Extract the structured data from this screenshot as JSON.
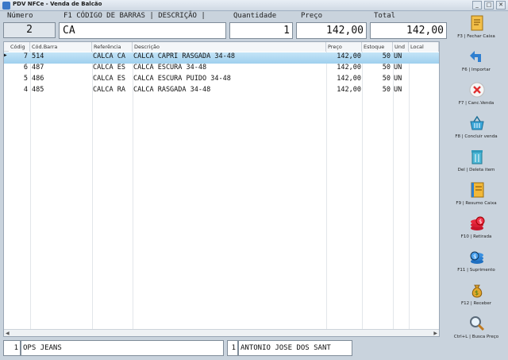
{
  "window": {
    "title": "PDV NFCe - Venda de Balcão"
  },
  "header": {
    "numero_label": "Número",
    "numero_value": "2",
    "busca_label": "F1 CÓDIGO DE BARRAS | DESCRIÇÃO |",
    "busca_value": "CA",
    "quantidade_label": "Quantidade",
    "quantidade_value": "1",
    "preco_label": "Preço",
    "preco_value": "142,00",
    "total_label": "Total",
    "total_value": "142,00"
  },
  "grid": {
    "columns": [
      "Códig",
      "Cód.Barra",
      "Referência",
      "Descrição",
      "Preço",
      "Estoque",
      "Und",
      "Local"
    ],
    "rows": [
      {
        "codigo": "7",
        "cod_barra": "514",
        "referencia": "CALCA CA",
        "descricao": "CALCA CAPRI RASGADA 34-48",
        "preco": "142,00",
        "estoque": "50",
        "und": "UN",
        "local": ""
      },
      {
        "codigo": "6",
        "cod_barra": "487",
        "referencia": "CALCA ES",
        "descricao": "CALCA ESCURA 34-48",
        "preco": "142,00",
        "estoque": "50",
        "und": "UN",
        "local": ""
      },
      {
        "codigo": "5",
        "cod_barra": "486",
        "referencia": "CALCA ES",
        "descricao": "CALCA ESCURA PUIDO 34-48",
        "preco": "142,00",
        "estoque": "50",
        "und": "UN",
        "local": ""
      },
      {
        "codigo": "4",
        "cod_barra": "485",
        "referencia": "CALCA RA",
        "descricao": "CALCA RASGADA 34-48",
        "preco": "142,00",
        "estoque": "50",
        "und": "UN",
        "local": ""
      }
    ],
    "selected_row": 0
  },
  "sidebar": {
    "items": [
      {
        "label": "F3 | Fechar Caixa",
        "icon": "receipt-icon"
      },
      {
        "label": "F6 | Importar",
        "icon": "import-arrow-icon"
      },
      {
        "label": "F7 | Canc.Venda",
        "icon": "cancel-x-icon"
      },
      {
        "label": "F8 | Concluir venda",
        "icon": "basket-icon"
      },
      {
        "label": "Del | Deleta item",
        "icon": "trash-icon"
      },
      {
        "label": "F9 | Resumo Caixa",
        "icon": "notebook-icon"
      },
      {
        "label": "F10 | Retirada",
        "icon": "coins-red-icon"
      },
      {
        "label": "F11 | Suprimento",
        "icon": "coins-blue-icon"
      },
      {
        "label": "F12 | Receber",
        "icon": "money-bag-icon"
      },
      {
        "label": "Ctrl+L | Busca Preço",
        "icon": "magnifier-icon"
      }
    ]
  },
  "footer": {
    "caixa_num": "1",
    "loja": "OPS JEANS",
    "vendedor_num": "1",
    "vendedor": "ANTONIO JOSE DOS SANT"
  },
  "colors": {
    "selected_row": "#a9d6f0",
    "background": "#c9d3dd"
  }
}
